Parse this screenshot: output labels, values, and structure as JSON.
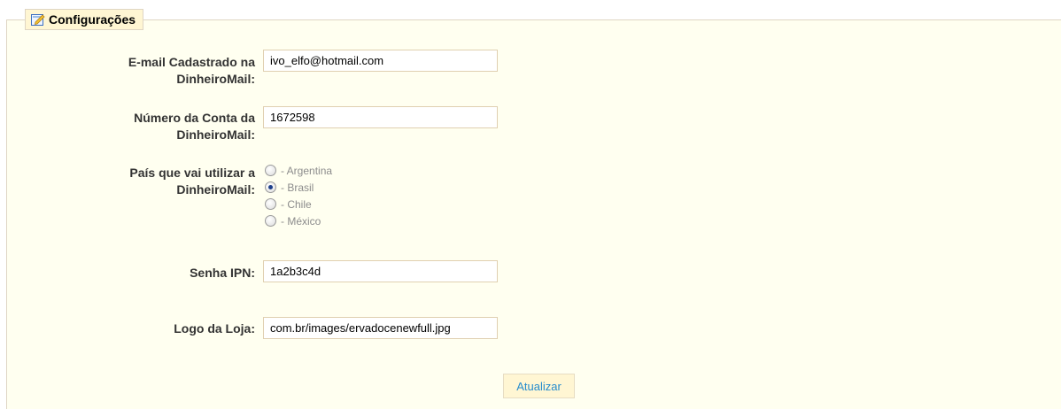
{
  "section": {
    "title": "Configurações",
    "icon": "edit-document-icon"
  },
  "fields": {
    "email": {
      "label_line1": "E-mail Cadastrado na",
      "label_line2": "DinheiroMail:",
      "value": "ivo_elfo@hotmail.com"
    },
    "account": {
      "label_line1": "Número da Conta da",
      "label_line2": "DinheiroMail:",
      "value": "1672598"
    },
    "country": {
      "label_line1": "País que vai utilizar a",
      "label_line2": "DinheiroMail:",
      "options": [
        {
          "label": "- Argentina",
          "checked": false
        },
        {
          "label": "- Brasil",
          "checked": true
        },
        {
          "label": "- Chile",
          "checked": false
        },
        {
          "label": "- México",
          "checked": false
        }
      ]
    },
    "ipn_password": {
      "label": "Senha IPN:",
      "value": "1a2b3c4d"
    },
    "store_logo": {
      "label": "Logo da Loja:",
      "value": "com.br/images/ervadocenewfull.jpg"
    }
  },
  "actions": {
    "update_label": "Atualizar"
  },
  "colors": {
    "panel_background": "#fffff0",
    "legend_background": "#fff6d3",
    "border": "#dfd5c3",
    "button_text": "#268ccd"
  }
}
